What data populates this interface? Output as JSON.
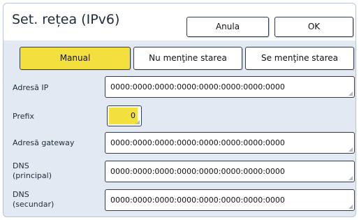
{
  "dialog": {
    "title": "Set. rețea (IPv6)",
    "cancel_label": "Anula",
    "ok_label": "OK"
  },
  "modes": [
    {
      "label": "Manual",
      "selected": true
    },
    {
      "label": "Nu menţine starea",
      "selected": false
    },
    {
      "label": "Se menţine starea",
      "selected": false
    }
  ],
  "fields": {
    "ip": {
      "label": "Adresă IP",
      "value": "0000:0000:0000:0000:0000:0000:0000:0000"
    },
    "prefix": {
      "label": "Prefix",
      "value": "0"
    },
    "gateway": {
      "label": "Adresă gateway",
      "value": "0000:0000:0000:0000:0000:0000:0000:0000"
    },
    "dns_primary": {
      "label_line1": "DNS",
      "label_line2": "(principal)",
      "value": "0000:0000:0000:0000:0000:0000:0000:0000"
    },
    "dns_secondary": {
      "label_line1": "DNS",
      "label_line2": "(secundar)",
      "value": "0000:0000:0000:0000:0000:0000:0000:0000"
    }
  },
  "colors": {
    "highlight": "#f3df3e",
    "panel": "#e3e9f3",
    "border": "#2f3d4f"
  }
}
